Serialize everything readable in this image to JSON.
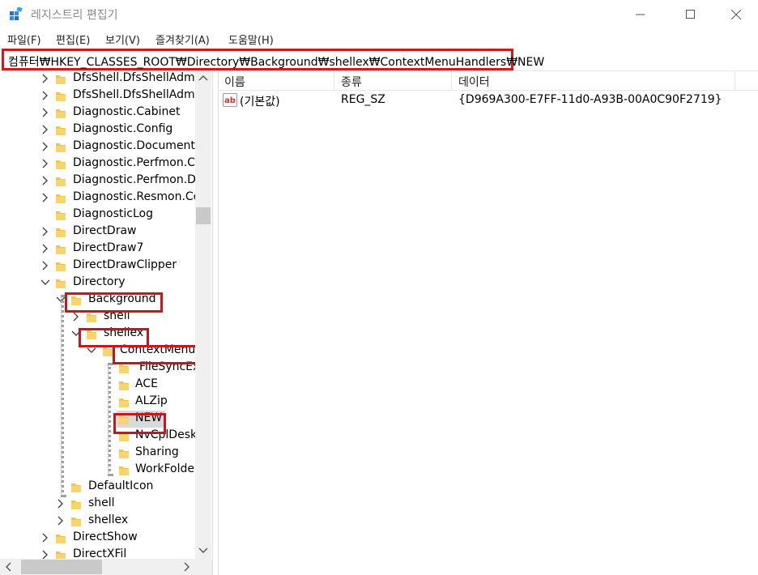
{
  "window": {
    "title": "레지스트리 편집기"
  },
  "menu": [
    "파일(F)",
    "편집(E)",
    "보기(V)",
    "즐겨찾기(A)",
    "도움말(H)"
  ],
  "address": "컴퓨터₩HKEY_CLASSES_ROOT₩Directory₩Background₩shellex₩ContextMenuHandlers₩NEW",
  "tree": {
    "items": [
      {
        "label": "DfsShell.DfsShellAdmin",
        "expander": "collapsed"
      },
      {
        "label": "DfsShell.DfsShellAdmin",
        "expander": "collapsed"
      },
      {
        "label": "Diagnostic.Cabinet",
        "expander": "collapsed"
      },
      {
        "label": "Diagnostic.Config",
        "expander": "collapsed"
      },
      {
        "label": "Diagnostic.Document",
        "expander": "collapsed"
      },
      {
        "label": "Diagnostic.Perfmon.Co",
        "expander": "collapsed"
      },
      {
        "label": "Diagnostic.Perfmon.Do",
        "expander": "collapsed"
      },
      {
        "label": "Diagnostic.Resmon.Co",
        "expander": "collapsed"
      },
      {
        "label": "DiagnosticLog",
        "expander": "none"
      },
      {
        "label": "DirectDraw",
        "expander": "collapsed"
      },
      {
        "label": "DirectDraw7",
        "expander": "collapsed"
      },
      {
        "label": "DirectDrawClipper",
        "expander": "collapsed"
      },
      {
        "label": "Directory",
        "expander": "expanded"
      },
      {
        "label": "Background",
        "expander": "expanded"
      },
      {
        "label": "shell",
        "expander": "collapsed"
      },
      {
        "label": "shellex",
        "expander": "expanded"
      },
      {
        "label": "ContextMenuH",
        "expander": "expanded"
      },
      {
        "label": "FileSyncEx",
        "expander": "none"
      },
      {
        "label": "ACE",
        "expander": "none"
      },
      {
        "label": "ALZip",
        "expander": "none"
      },
      {
        "label": "NEW",
        "expander": "none"
      },
      {
        "label": "NvCplDeskt",
        "expander": "none"
      },
      {
        "label": "Sharing",
        "expander": "none"
      },
      {
        "label": "WorkFolder",
        "expander": "none"
      },
      {
        "label": "DefaultIcon",
        "expander": "none"
      },
      {
        "label": "shell",
        "expander": "collapsed"
      },
      {
        "label": "shellex",
        "expander": "collapsed"
      },
      {
        "label": "DirectShow",
        "expander": "collapsed"
      },
      {
        "label": "DirectXFil",
        "expander": "collapsed"
      }
    ]
  },
  "list": {
    "columns": [
      "이름",
      "종류",
      "데이터"
    ],
    "rows": [
      {
        "name": "(기본값)",
        "type": "REG_SZ",
        "data": "{D969A300-E7FF-11d0-A93B-00A0C90F2719}",
        "icon": "string-value-icon"
      }
    ]
  },
  "colors": {
    "highlight": "#c8171b",
    "folder": "#f3c54a",
    "selection": "#d9d9d9"
  }
}
